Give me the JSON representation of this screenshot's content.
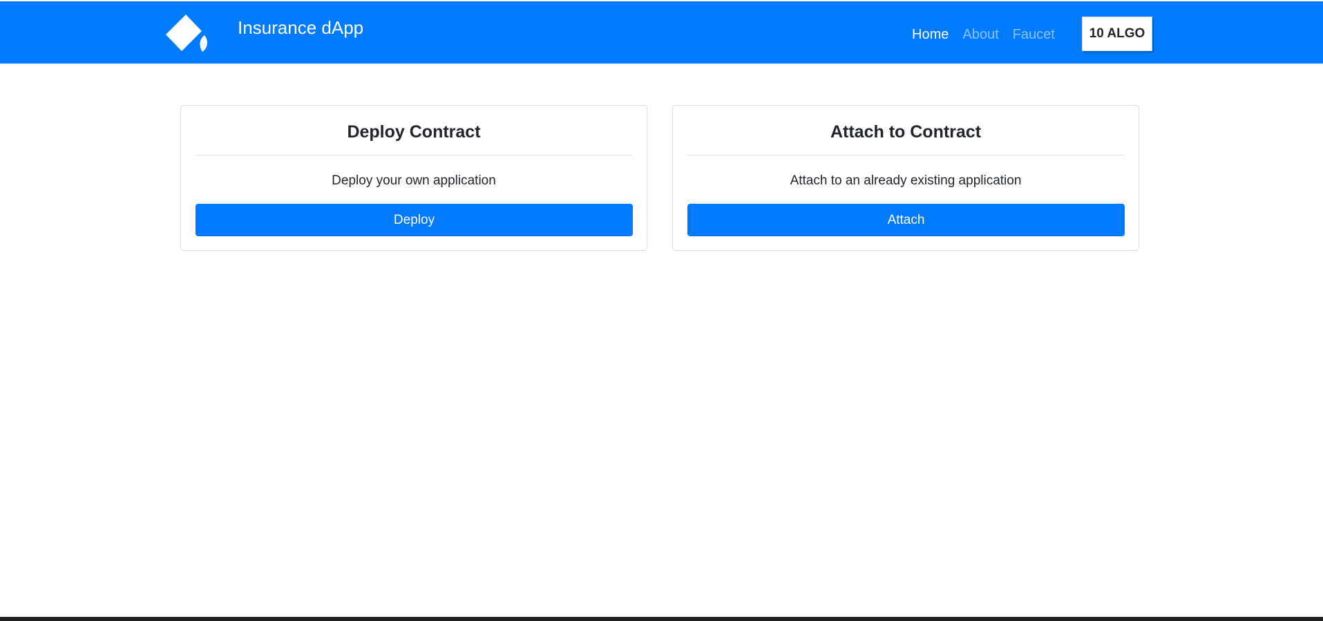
{
  "app": {
    "title": "Insurance dApp"
  },
  "nav": {
    "links": [
      {
        "label": "Home",
        "active": true
      },
      {
        "label": "About",
        "active": false
      },
      {
        "label": "Faucet",
        "active": false
      }
    ],
    "balance": "10 ALGO"
  },
  "cards": [
    {
      "title": "Deploy Contract",
      "text": "Deploy your own application",
      "button_label": "Deploy"
    },
    {
      "title": "Attach to Contract",
      "text": "Attach to an already existing application",
      "button_label": "Attach"
    }
  ],
  "colors": {
    "primary": "#007bff",
    "nav_inactive": "rgba(255,255,255,0.55)",
    "text": "#212529"
  },
  "icons": {
    "logo": "algorand-logo-icon"
  }
}
